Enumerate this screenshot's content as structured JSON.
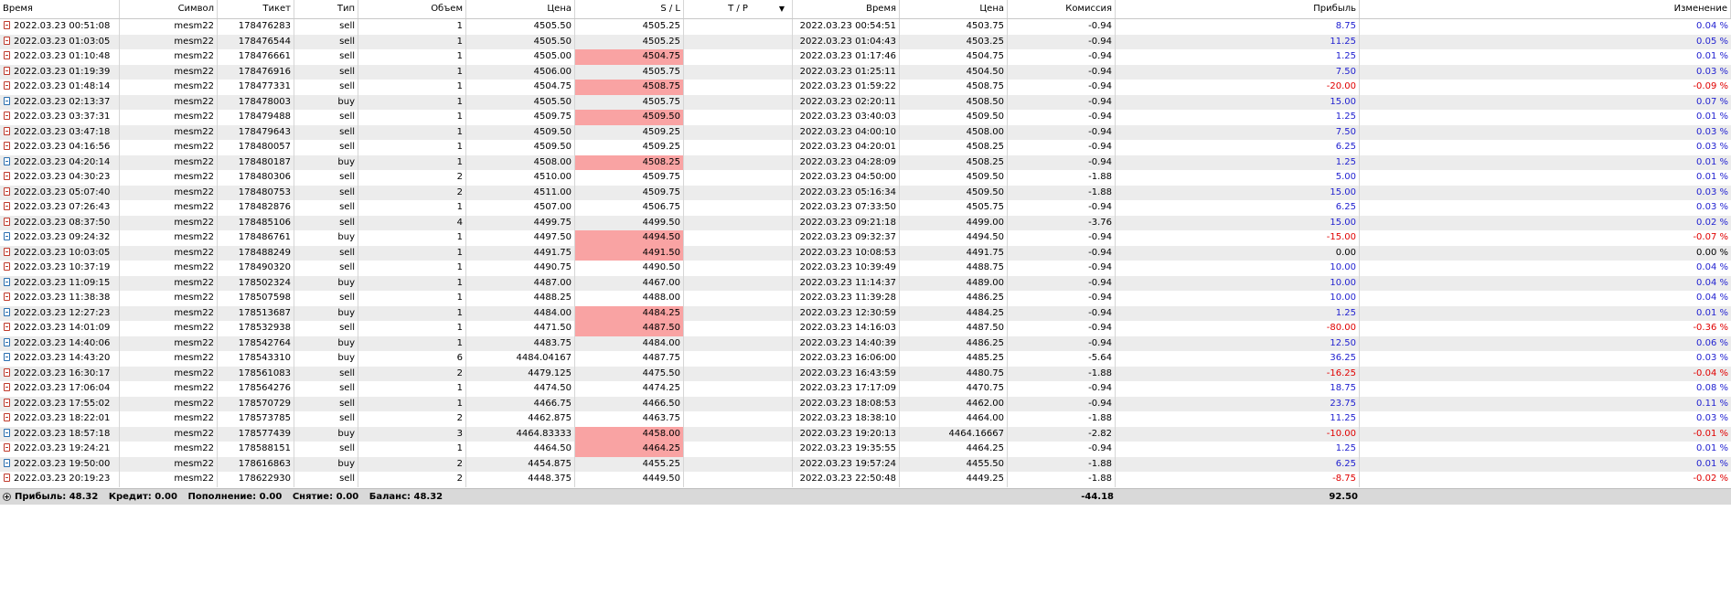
{
  "columns": [
    "Время",
    "Символ",
    "Тикет",
    "Тип",
    "Объем",
    "Цена",
    "S / L",
    "T / P",
    "Время",
    "Цена",
    "Комиссия",
    "Прибыль",
    "Изменение"
  ],
  "rows": [
    {
      "open_time": "2022.03.23 00:51:08",
      "symbol": "mesm22",
      "ticket": "178476283",
      "type": "sell",
      "volume": "1",
      "price": "4505.50",
      "sl": "4505.25",
      "sl_hit": false,
      "tp": "",
      "close_time": "2022.03.23 00:54:51",
      "close_price": "4503.75",
      "commission": "-0.94",
      "profit": "8.75",
      "change": "0.04 %",
      "sign": "pos"
    },
    {
      "open_time": "2022.03.23 01:03:05",
      "symbol": "mesm22",
      "ticket": "178476544",
      "type": "sell",
      "volume": "1",
      "price": "4505.50",
      "sl": "4505.25",
      "sl_hit": false,
      "tp": "",
      "close_time": "2022.03.23 01:04:43",
      "close_price": "4503.25",
      "commission": "-0.94",
      "profit": "11.25",
      "change": "0.05 %",
      "sign": "pos"
    },
    {
      "open_time": "2022.03.23 01:10:48",
      "symbol": "mesm22",
      "ticket": "178476661",
      "type": "sell",
      "volume": "1",
      "price": "4505.00",
      "sl": "4504.75",
      "sl_hit": true,
      "tp": "",
      "close_time": "2022.03.23 01:17:46",
      "close_price": "4504.75",
      "commission": "-0.94",
      "profit": "1.25",
      "change": "0.01 %",
      "sign": "pos"
    },
    {
      "open_time": "2022.03.23 01:19:39",
      "symbol": "mesm22",
      "ticket": "178476916",
      "type": "sell",
      "volume": "1",
      "price": "4506.00",
      "sl": "4505.75",
      "sl_hit": false,
      "tp": "",
      "close_time": "2022.03.23 01:25:11",
      "close_price": "4504.50",
      "commission": "-0.94",
      "profit": "7.50",
      "change": "0.03 %",
      "sign": "pos"
    },
    {
      "open_time": "2022.03.23 01:48:14",
      "symbol": "mesm22",
      "ticket": "178477331",
      "type": "sell",
      "volume": "1",
      "price": "4504.75",
      "sl": "4508.75",
      "sl_hit": true,
      "tp": "",
      "close_time": "2022.03.23 01:59:22",
      "close_price": "4508.75",
      "commission": "-0.94",
      "profit": "-20.00",
      "change": "-0.09 %",
      "sign": "neg"
    },
    {
      "open_time": "2022.03.23 02:13:37",
      "symbol": "mesm22",
      "ticket": "178478003",
      "type": "buy",
      "volume": "1",
      "price": "4505.50",
      "sl": "4505.75",
      "sl_hit": false,
      "tp": "",
      "close_time": "2022.03.23 02:20:11",
      "close_price": "4508.50",
      "commission": "-0.94",
      "profit": "15.00",
      "change": "0.07 %",
      "sign": "pos"
    },
    {
      "open_time": "2022.03.23 03:37:31",
      "symbol": "mesm22",
      "ticket": "178479488",
      "type": "sell",
      "volume": "1",
      "price": "4509.75",
      "sl": "4509.50",
      "sl_hit": true,
      "tp": "",
      "close_time": "2022.03.23 03:40:03",
      "close_price": "4509.50",
      "commission": "-0.94",
      "profit": "1.25",
      "change": "0.01 %",
      "sign": "pos"
    },
    {
      "open_time": "2022.03.23 03:47:18",
      "symbol": "mesm22",
      "ticket": "178479643",
      "type": "sell",
      "volume": "1",
      "price": "4509.50",
      "sl": "4509.25",
      "sl_hit": false,
      "tp": "",
      "close_time": "2022.03.23 04:00:10",
      "close_price": "4508.00",
      "commission": "-0.94",
      "profit": "7.50",
      "change": "0.03 %",
      "sign": "pos"
    },
    {
      "open_time": "2022.03.23 04:16:56",
      "symbol": "mesm22",
      "ticket": "178480057",
      "type": "sell",
      "volume": "1",
      "price": "4509.50",
      "sl": "4509.25",
      "sl_hit": false,
      "tp": "",
      "close_time": "2022.03.23 04:20:01",
      "close_price": "4508.25",
      "commission": "-0.94",
      "profit": "6.25",
      "change": "0.03 %",
      "sign": "pos"
    },
    {
      "open_time": "2022.03.23 04:20:14",
      "symbol": "mesm22",
      "ticket": "178480187",
      "type": "buy",
      "volume": "1",
      "price": "4508.00",
      "sl": "4508.25",
      "sl_hit": true,
      "tp": "",
      "close_time": "2022.03.23 04:28:09",
      "close_price": "4508.25",
      "commission": "-0.94",
      "profit": "1.25",
      "change": "0.01 %",
      "sign": "pos"
    },
    {
      "open_time": "2022.03.23 04:30:23",
      "symbol": "mesm22",
      "ticket": "178480306",
      "type": "sell",
      "volume": "2",
      "price": "4510.00",
      "sl": "4509.75",
      "sl_hit": false,
      "tp": "",
      "close_time": "2022.03.23 04:50:00",
      "close_price": "4509.50",
      "commission": "-1.88",
      "profit": "5.00",
      "change": "0.01 %",
      "sign": "pos"
    },
    {
      "open_time": "2022.03.23 05:07:40",
      "symbol": "mesm22",
      "ticket": "178480753",
      "type": "sell",
      "volume": "2",
      "price": "4511.00",
      "sl": "4509.75",
      "sl_hit": false,
      "tp": "",
      "close_time": "2022.03.23 05:16:34",
      "close_price": "4509.50",
      "commission": "-1.88",
      "profit": "15.00",
      "change": "0.03 %",
      "sign": "pos"
    },
    {
      "open_time": "2022.03.23 07:26:43",
      "symbol": "mesm22",
      "ticket": "178482876",
      "type": "sell",
      "volume": "1",
      "price": "4507.00",
      "sl": "4506.75",
      "sl_hit": false,
      "tp": "",
      "close_time": "2022.03.23 07:33:50",
      "close_price": "4505.75",
      "commission": "-0.94",
      "profit": "6.25",
      "change": "0.03 %",
      "sign": "pos"
    },
    {
      "open_time": "2022.03.23 08:37:50",
      "symbol": "mesm22",
      "ticket": "178485106",
      "type": "sell",
      "volume": "4",
      "price": "4499.75",
      "sl": "4499.50",
      "sl_hit": false,
      "tp": "",
      "close_time": "2022.03.23 09:21:18",
      "close_price": "4499.00",
      "commission": "-3.76",
      "profit": "15.00",
      "change": "0.02 %",
      "sign": "pos"
    },
    {
      "open_time": "2022.03.23 09:24:32",
      "symbol": "mesm22",
      "ticket": "178486761",
      "type": "buy",
      "volume": "1",
      "price": "4497.50",
      "sl": "4494.50",
      "sl_hit": true,
      "tp": "",
      "close_time": "2022.03.23 09:32:37",
      "close_price": "4494.50",
      "commission": "-0.94",
      "profit": "-15.00",
      "change": "-0.07 %",
      "sign": "neg"
    },
    {
      "open_time": "2022.03.23 10:03:05",
      "symbol": "mesm22",
      "ticket": "178488249",
      "type": "sell",
      "volume": "1",
      "price": "4491.75",
      "sl": "4491.50",
      "sl_hit": true,
      "tp": "",
      "close_time": "2022.03.23 10:08:53",
      "close_price": "4491.75",
      "commission": "-0.94",
      "profit": "0.00",
      "change": "0.00 %",
      "sign": "zero"
    },
    {
      "open_time": "2022.03.23 10:37:19",
      "symbol": "mesm22",
      "ticket": "178490320",
      "type": "sell",
      "volume": "1",
      "price": "4490.75",
      "sl": "4490.50",
      "sl_hit": false,
      "tp": "",
      "close_time": "2022.03.23 10:39:49",
      "close_price": "4488.75",
      "commission": "-0.94",
      "profit": "10.00",
      "change": "0.04 %",
      "sign": "pos"
    },
    {
      "open_time": "2022.03.23 11:09:15",
      "symbol": "mesm22",
      "ticket": "178502324",
      "type": "buy",
      "volume": "1",
      "price": "4487.00",
      "sl": "4467.00",
      "sl_hit": false,
      "tp": "",
      "close_time": "2022.03.23 11:14:37",
      "close_price": "4489.00",
      "commission": "-0.94",
      "profit": "10.00",
      "change": "0.04 %",
      "sign": "pos"
    },
    {
      "open_time": "2022.03.23 11:38:38",
      "symbol": "mesm22",
      "ticket": "178507598",
      "type": "sell",
      "volume": "1",
      "price": "4488.25",
      "sl": "4488.00",
      "sl_hit": false,
      "tp": "",
      "close_time": "2022.03.23 11:39:28",
      "close_price": "4486.25",
      "commission": "-0.94",
      "profit": "10.00",
      "change": "0.04 %",
      "sign": "pos"
    },
    {
      "open_time": "2022.03.23 12:27:23",
      "symbol": "mesm22",
      "ticket": "178513687",
      "type": "buy",
      "volume": "1",
      "price": "4484.00",
      "sl": "4484.25",
      "sl_hit": true,
      "tp": "",
      "close_time": "2022.03.23 12:30:59",
      "close_price": "4484.25",
      "commission": "-0.94",
      "profit": "1.25",
      "change": "0.01 %",
      "sign": "pos"
    },
    {
      "open_time": "2022.03.23 14:01:09",
      "symbol": "mesm22",
      "ticket": "178532938",
      "type": "sell",
      "volume": "1",
      "price": "4471.50",
      "sl": "4487.50",
      "sl_hit": true,
      "tp": "",
      "close_time": "2022.03.23 14:16:03",
      "close_price": "4487.50",
      "commission": "-0.94",
      "profit": "-80.00",
      "change": "-0.36 %",
      "sign": "neg"
    },
    {
      "open_time": "2022.03.23 14:40:06",
      "symbol": "mesm22",
      "ticket": "178542764",
      "type": "buy",
      "volume": "1",
      "price": "4483.75",
      "sl": "4484.00",
      "sl_hit": false,
      "tp": "",
      "close_time": "2022.03.23 14:40:39",
      "close_price": "4486.25",
      "commission": "-0.94",
      "profit": "12.50",
      "change": "0.06 %",
      "sign": "pos"
    },
    {
      "open_time": "2022.03.23 14:43:20",
      "symbol": "mesm22",
      "ticket": "178543310",
      "type": "buy",
      "volume": "6",
      "price": "4484.04167",
      "sl": "4487.75",
      "sl_hit": false,
      "tp": "",
      "close_time": "2022.03.23 16:06:00",
      "close_price": "4485.25",
      "commission": "-5.64",
      "profit": "36.25",
      "change": "0.03 %",
      "sign": "pos"
    },
    {
      "open_time": "2022.03.23 16:30:17",
      "symbol": "mesm22",
      "ticket": "178561083",
      "type": "sell",
      "volume": "2",
      "price": "4479.125",
      "sl": "4475.50",
      "sl_hit": false,
      "tp": "",
      "close_time": "2022.03.23 16:43:59",
      "close_price": "4480.75",
      "commission": "-1.88",
      "profit": "-16.25",
      "change": "-0.04 %",
      "sign": "neg"
    },
    {
      "open_time": "2022.03.23 17:06:04",
      "symbol": "mesm22",
      "ticket": "178564276",
      "type": "sell",
      "volume": "1",
      "price": "4474.50",
      "sl": "4474.25",
      "sl_hit": false,
      "tp": "",
      "close_time": "2022.03.23 17:17:09",
      "close_price": "4470.75",
      "commission": "-0.94",
      "profit": "18.75",
      "change": "0.08 %",
      "sign": "pos"
    },
    {
      "open_time": "2022.03.23 17:55:02",
      "symbol": "mesm22",
      "ticket": "178570729",
      "type": "sell",
      "volume": "1",
      "price": "4466.75",
      "sl": "4466.50",
      "sl_hit": false,
      "tp": "",
      "close_time": "2022.03.23 18:08:53",
      "close_price": "4462.00",
      "commission": "-0.94",
      "profit": "23.75",
      "change": "0.11 %",
      "sign": "pos"
    },
    {
      "open_time": "2022.03.23 18:22:01",
      "symbol": "mesm22",
      "ticket": "178573785",
      "type": "sell",
      "volume": "2",
      "price": "4462.875",
      "sl": "4463.75",
      "sl_hit": false,
      "tp": "",
      "close_time": "2022.03.23 18:38:10",
      "close_price": "4464.00",
      "commission": "-1.88",
      "profit": "11.25",
      "change": "0.03 %",
      "sign": "pos"
    },
    {
      "open_time": "2022.03.23 18:57:18",
      "symbol": "mesm22",
      "ticket": "178577439",
      "type": "buy",
      "volume": "3",
      "price": "4464.83333",
      "sl": "4458.00",
      "sl_hit": true,
      "tp": "",
      "close_time": "2022.03.23 19:20:13",
      "close_price": "4464.16667",
      "commission": "-2.82",
      "profit": "-10.00",
      "change": "-0.01 %",
      "sign": "neg"
    },
    {
      "open_time": "2022.03.23 19:24:21",
      "symbol": "mesm22",
      "ticket": "178588151",
      "type": "sell",
      "volume": "1",
      "price": "4464.50",
      "sl": "4464.25",
      "sl_hit": true,
      "tp": "",
      "close_time": "2022.03.23 19:35:55",
      "close_price": "4464.25",
      "commission": "-0.94",
      "profit": "1.25",
      "change": "0.01 %",
      "sign": "pos"
    },
    {
      "open_time": "2022.03.23 19:50:00",
      "symbol": "mesm22",
      "ticket": "178616863",
      "type": "buy",
      "volume": "2",
      "price": "4454.875",
      "sl": "4455.25",
      "sl_hit": false,
      "tp": "",
      "close_time": "2022.03.23 19:57:24",
      "close_price": "4455.50",
      "commission": "-1.88",
      "profit": "6.25",
      "change": "0.01 %",
      "sign": "pos"
    },
    {
      "open_time": "2022.03.23 20:19:23",
      "symbol": "mesm22",
      "ticket": "178622930",
      "type": "sell",
      "volume": "2",
      "price": "4448.375",
      "sl": "4449.50",
      "sl_hit": false,
      "tp": "",
      "close_time": "2022.03.23 22:50:48",
      "close_price": "4449.25",
      "commission": "-1.88",
      "profit": "-8.75",
      "change": "-0.02 %",
      "sign": "neg"
    }
  ],
  "footer": {
    "profit": "Прибыль: 48.32",
    "credit": "Кредит: 0.00",
    "deposit": "Пополнение: 0.00",
    "withdrawal": "Снятие: 0.00",
    "balance": "Баланс: 48.32",
    "total_commission": "-44.18",
    "total_profit": "92.50"
  },
  "colors": {
    "profit_positive": "#1f1fd0",
    "profit_negative": "#e00000",
    "sl_hit_highlight": "#f9a3a3",
    "row_alt": "#ececec",
    "footer_bg": "#d9d9d9"
  },
  "icons": {
    "sell_row": "sell-order-icon",
    "buy_row": "buy-order-icon",
    "footer": "expand-plus-icon",
    "tp_sort": "sort-down-arrow-icon"
  }
}
